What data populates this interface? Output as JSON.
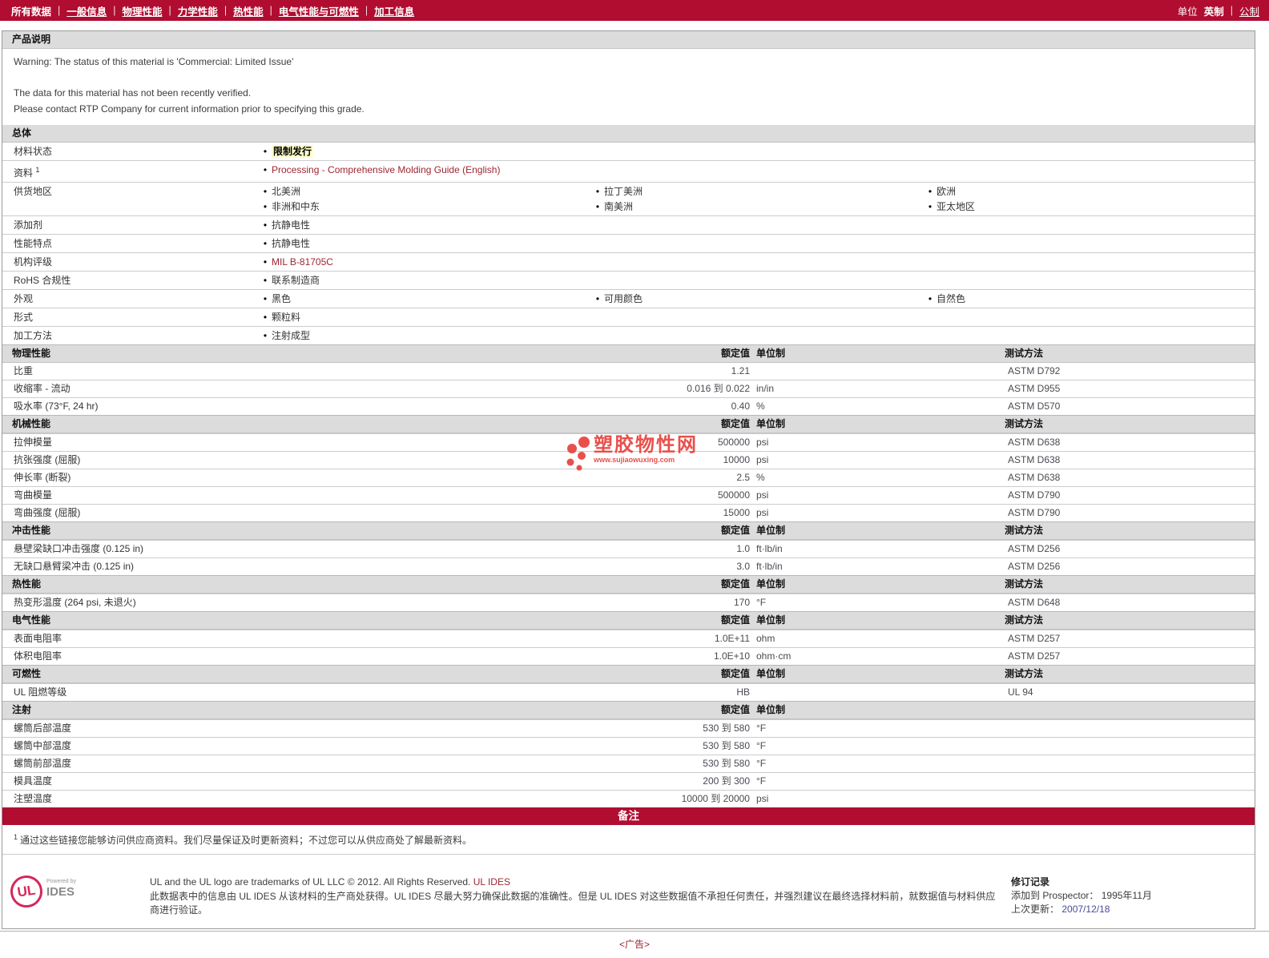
{
  "colors": {
    "accent": "#b00d31",
    "link": "#9e2533",
    "highlight_bg": "#ffffcc",
    "watermark_red": "#e8423d",
    "date_blue": "#4a4a9c"
  },
  "bullet": "•",
  "nav": {
    "items": [
      {
        "label": "所有数据",
        "active": true
      },
      {
        "label": "一般信息",
        "active": false
      },
      {
        "label": "物理性能",
        "active": false
      },
      {
        "label": "力学性能",
        "active": false
      },
      {
        "label": "热性能",
        "active": false
      },
      {
        "label": "电气性能与可燃性",
        "active": false
      },
      {
        "label": "加工信息",
        "active": false
      }
    ],
    "separator": "|",
    "units_label": "单位",
    "units": [
      {
        "label": "英制",
        "active": true
      },
      {
        "label": "公制",
        "active": false
      }
    ]
  },
  "product_description": {
    "header": "产品说明",
    "warning_line": "Warning: The status of this material is 'Commercial: Limited Issue'",
    "line2": "The data for this material has not been recently verified.",
    "line3": "Please contact RTP Company for current information prior to specifying this grade."
  },
  "general": {
    "header": "总体",
    "rows": [
      {
        "label": "材料状态",
        "sup": "",
        "style": "highlight",
        "cols": [
          [
            "限制发行"
          ],
          [],
          []
        ]
      },
      {
        "label": "资料",
        "sup": "1",
        "style": "link",
        "cols": [
          [
            "Processing - Comprehensive Molding Guide (English)"
          ],
          [],
          []
        ]
      },
      {
        "label": "供货地区",
        "sup": "",
        "style": "plain",
        "cols": [
          [
            "北美洲",
            "非洲和中东"
          ],
          [
            "拉丁美洲",
            "南美洲"
          ],
          [
            "欧洲",
            "亚太地区"
          ]
        ]
      },
      {
        "label": "添加剂",
        "sup": "",
        "style": "plain",
        "cols": [
          [
            "抗静电性"
          ],
          [],
          []
        ]
      },
      {
        "label": "性能特点",
        "sup": "",
        "style": "plain",
        "cols": [
          [
            "抗静电性"
          ],
          [],
          []
        ]
      },
      {
        "label": "机构评级",
        "sup": "",
        "style": "link",
        "cols": [
          [
            "MIL B-81705C"
          ],
          [],
          []
        ]
      },
      {
        "label": "RoHS 合规性",
        "sup": "",
        "style": "plain",
        "cols": [
          [
            "联系制造商"
          ],
          [],
          []
        ]
      },
      {
        "label": "外观",
        "sup": "",
        "style": "plain",
        "cols": [
          [
            "黑色"
          ],
          [
            "可用颜色"
          ],
          [
            "自然色"
          ]
        ]
      },
      {
        "label": "形式",
        "sup": "",
        "style": "plain",
        "cols": [
          [
            "颗粒料"
          ],
          [],
          []
        ]
      },
      {
        "label": "加工方法",
        "sup": "",
        "style": "plain",
        "cols": [
          [
            "注射成型"
          ],
          [],
          []
        ]
      }
    ]
  },
  "table_heads": {
    "value": "额定值",
    "unit": "单位制",
    "method": "测试方法"
  },
  "tables": [
    {
      "title": "物理性能",
      "show_method": true,
      "rows": [
        {
          "label": "比重",
          "value": "1.21",
          "unit": "",
          "method": "ASTM D792"
        },
        {
          "label": "收缩率 - 流动",
          "value": "0.016 到  0.022",
          "unit": "in/in",
          "method": "ASTM D955"
        },
        {
          "label": "吸水率 (73°F, 24 hr)",
          "value": "0.40",
          "unit": "%",
          "method": "ASTM D570"
        }
      ]
    },
    {
      "title": "机械性能",
      "show_method": true,
      "rows": [
        {
          "label": "拉伸模量",
          "value": "500000",
          "unit": "psi",
          "method": "ASTM D638"
        },
        {
          "label": "抗张强度 (屈服)",
          "value": "10000",
          "unit": "psi",
          "method": "ASTM D638"
        },
        {
          "label": "伸长率 (断裂)",
          "value": "2.5",
          "unit": "%",
          "method": "ASTM D638"
        },
        {
          "label": "弯曲模量",
          "value": "500000",
          "unit": "psi",
          "method": "ASTM D790"
        },
        {
          "label": "弯曲强度 (屈服)",
          "value": "15000",
          "unit": "psi",
          "method": "ASTM D790"
        }
      ]
    },
    {
      "title": "冲击性能",
      "show_method": true,
      "rows": [
        {
          "label": "悬壁梁缺口冲击强度 (0.125 in)",
          "value": "1.0",
          "unit": "ft·lb/in",
          "method": "ASTM D256"
        },
        {
          "label": "无缺口悬臂梁冲击 (0.125 in)",
          "value": "3.0",
          "unit": "ft·lb/in",
          "method": "ASTM D256"
        }
      ]
    },
    {
      "title": "热性能",
      "show_method": true,
      "rows": [
        {
          "label": "热变形温度 (264 psi, 未退火)",
          "value": "170",
          "unit": "°F",
          "method": "ASTM D648"
        }
      ]
    },
    {
      "title": "电气性能",
      "show_method": true,
      "rows": [
        {
          "label": "表面电阻率",
          "value": "1.0E+11",
          "unit": "ohm",
          "method": "ASTM D257"
        },
        {
          "label": "体积电阻率",
          "value": "1.0E+10",
          "unit": "ohm·cm",
          "method": "ASTM D257"
        }
      ]
    },
    {
      "title": "可燃性",
      "show_method": true,
      "rows": [
        {
          "label": "UL 阻燃等级",
          "value": "HB",
          "unit": "",
          "method": "UL 94"
        }
      ]
    },
    {
      "title": "注射",
      "show_method": false,
      "rows": [
        {
          "label": "螺筒后部温度",
          "value": "530 到  580",
          "unit": "°F",
          "method": ""
        },
        {
          "label": "螺筒中部温度",
          "value": "530 到  580",
          "unit": "°F",
          "method": ""
        },
        {
          "label": "螺筒前部温度",
          "value": "530 到  580",
          "unit": "°F",
          "method": ""
        },
        {
          "label": "模具温度",
          "value": "200 到  300",
          "unit": "°F",
          "method": ""
        },
        {
          "label": "注塑温度",
          "value": "10000 到  20000",
          "unit": "psi",
          "method": ""
        }
      ]
    }
  ],
  "notes": {
    "banner": "备注",
    "footnote_sup": "1",
    "footnote_text": "通过这些链接您能够访问供应商资料。我们尽量保证及时更新资料；不过您可以从供应商处了解最新资料。"
  },
  "footer": {
    "logo_ul": "UL",
    "logo_powered": "Powered by",
    "logo_ides": "IDES",
    "english": "UL and the UL logo are trademarks of UL LLC © 2012. All Rights Reserved.",
    "english_link": "UL IDES",
    "chinese": "此数据表中的信息由  UL IDES 从该材料的生产商处获得。UL IDES 尽最大努力确保此数据的准确性。但是  UL IDES 对这些数据值不承担任何责任，并强烈建议在最终选择材料前，就数据值与材料供应商进行验证。",
    "revision": {
      "title": "修订记录",
      "added_label": "添加到  Prospector：",
      "added_value": "1995年11月",
      "updated_label": "上次更新：",
      "updated_value": "2007/12/18"
    }
  },
  "watermark": {
    "title": "塑胶物性网",
    "url": "www.sujiaowuxing.com"
  },
  "ad": {
    "label": "<广告>"
  }
}
